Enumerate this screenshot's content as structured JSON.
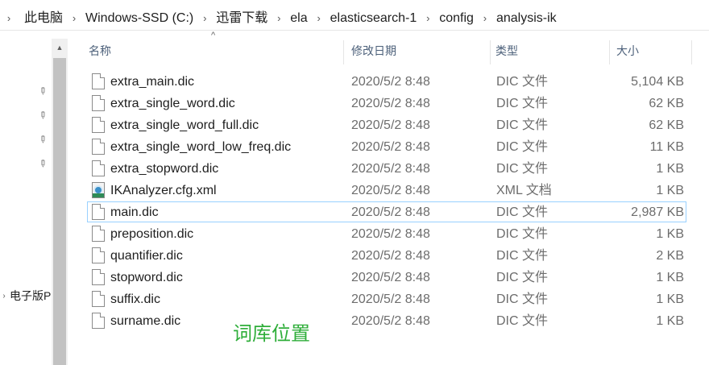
{
  "breadcrumb": [
    "此电脑",
    "Windows-SSD (C:)",
    "迅雷下载",
    "ela",
    "elasticsearch-1",
    "config",
    "analysis-ik"
  ],
  "nav": {
    "device_label": "电子版P"
  },
  "columns": {
    "name": "名称",
    "date": "修改日期",
    "type": "类型",
    "size": "大小"
  },
  "files": [
    {
      "name": "extra_main.dic",
      "date": "2020/5/2 8:48",
      "type": "DIC 文件",
      "size": "5,104 KB",
      "icon": "file-icon"
    },
    {
      "name": "extra_single_word.dic",
      "date": "2020/5/2 8:48",
      "type": "DIC 文件",
      "size": "62 KB",
      "icon": "file-icon"
    },
    {
      "name": "extra_single_word_full.dic",
      "date": "2020/5/2 8:48",
      "type": "DIC 文件",
      "size": "62 KB",
      "icon": "file-icon"
    },
    {
      "name": "extra_single_word_low_freq.dic",
      "date": "2020/5/2 8:48",
      "type": "DIC 文件",
      "size": "11 KB",
      "icon": "file-icon"
    },
    {
      "name": "extra_stopword.dic",
      "date": "2020/5/2 8:48",
      "type": "DIC 文件",
      "size": "1 KB",
      "icon": "file-icon"
    },
    {
      "name": "IKAnalyzer.cfg.xml",
      "date": "2020/5/2 8:48",
      "type": "XML 文档",
      "size": "1 KB",
      "icon": "xml-file-icon"
    },
    {
      "name": "main.dic",
      "date": "2020/5/2 8:48",
      "type": "DIC 文件",
      "size": "2,987 KB",
      "icon": "file-icon"
    },
    {
      "name": "preposition.dic",
      "date": "2020/5/2 8:48",
      "type": "DIC 文件",
      "size": "1 KB",
      "icon": "file-icon"
    },
    {
      "name": "quantifier.dic",
      "date": "2020/5/2 8:48",
      "type": "DIC 文件",
      "size": "2 KB",
      "icon": "file-icon"
    },
    {
      "name": "stopword.dic",
      "date": "2020/5/2 8:48",
      "type": "DIC 文件",
      "size": "1 KB",
      "icon": "file-icon"
    },
    {
      "name": "suffix.dic",
      "date": "2020/5/2 8:48",
      "type": "DIC 文件",
      "size": "1 KB",
      "icon": "file-icon"
    },
    {
      "name": "surname.dic",
      "date": "2020/5/2 8:48",
      "type": "DIC 文件",
      "size": "1 KB",
      "icon": "file-icon"
    }
  ],
  "annotation": "词库位置",
  "colors": {
    "annotation": "#2fae3a",
    "focus_border": "#99d1ff",
    "header_text": "#4c607a"
  }
}
